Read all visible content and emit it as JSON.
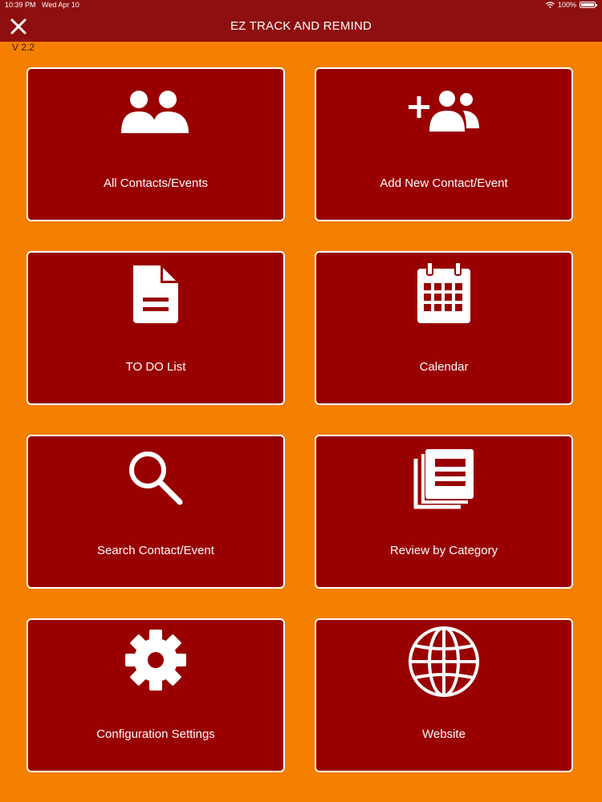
{
  "status_bar": {
    "time": "10:39 PM",
    "date": "Wed Apr 10",
    "battery": "100%"
  },
  "header": {
    "title": "EZ TRACK AND REMIND",
    "version": "V 2.2"
  },
  "tiles": [
    {
      "label": "All Contacts/Events",
      "icon": "contacts-icon"
    },
    {
      "label": "Add New Contact/Event",
      "icon": "add-contact-icon"
    },
    {
      "label": "TO DO List",
      "icon": "document-icon"
    },
    {
      "label": "Calendar",
      "icon": "calendar-icon"
    },
    {
      "label": "Search Contact/Event",
      "icon": "search-icon"
    },
    {
      "label": "Review by Category",
      "icon": "category-list-icon"
    },
    {
      "label": "Configuration Settings",
      "icon": "gear-icon"
    },
    {
      "label": "Website",
      "icon": "globe-icon"
    }
  ],
  "colors": {
    "background": "#f47f00",
    "header": "#8e0f10",
    "tile": "#990000",
    "text": "#ffffff"
  }
}
